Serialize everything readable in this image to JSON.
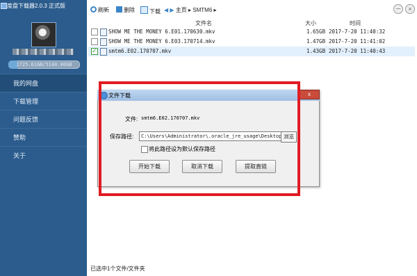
{
  "app": {
    "title": "度盘下载器2.0.3 正式版"
  },
  "sidebar": {
    "quota_text": "1725.61GB/5140.00GB",
    "quota_fraction": 0.336,
    "items": [
      {
        "label": "我的网盘",
        "active": true
      },
      {
        "label": "下载管理",
        "active": false
      },
      {
        "label": "问题反馈",
        "active": false
      },
      {
        "label": "赞助",
        "active": false
      },
      {
        "label": "关于",
        "active": false
      }
    ]
  },
  "window_controls": {
    "minimize": "－",
    "close": "×"
  },
  "toolbar": {
    "refresh": "刷新",
    "delete": "删除",
    "download": "下载",
    "home": "主页",
    "path": "SMTM6"
  },
  "table": {
    "headers": {
      "name": "文件名",
      "size": "大小",
      "time": "时间"
    },
    "rows": [
      {
        "name": "SHOW ME THE MONEY 6.E01.170630.mkv",
        "size": "1.65GB",
        "time": "2017-7-20 11:40:32",
        "checked": false
      },
      {
        "name": "SHOW ME THE MONEY 6.E03.170714.mkv",
        "size": "1.47GB",
        "time": "2017-7-20 11:41:02",
        "checked": false
      },
      {
        "name": "smtm6.E02.170707.mkv",
        "size": "1.43GB",
        "time": "2017-7-20 11:40:43",
        "checked": true
      }
    ]
  },
  "status": {
    "text": "已选中1个文件/文件夹"
  },
  "dialog": {
    "title": "文件下载",
    "close": "x",
    "file_label": "文件:",
    "file_name": "smtm6.E02.170707.mkv",
    "save_label": "保存路径:",
    "save_path": "C:\\Users\\Administrator\\.oracle_jre_usage\\Desktop\\度盘",
    "browse": "浏览",
    "default_path_label": "将此路径设为默认保存路径",
    "start_button": "开始下载",
    "cancel_button": "取消下载",
    "link_button": "提取直链"
  },
  "colors": {
    "sidebar": "#2b5c8d",
    "annotation": "#e01c24",
    "selected_row": "#e2effc"
  }
}
